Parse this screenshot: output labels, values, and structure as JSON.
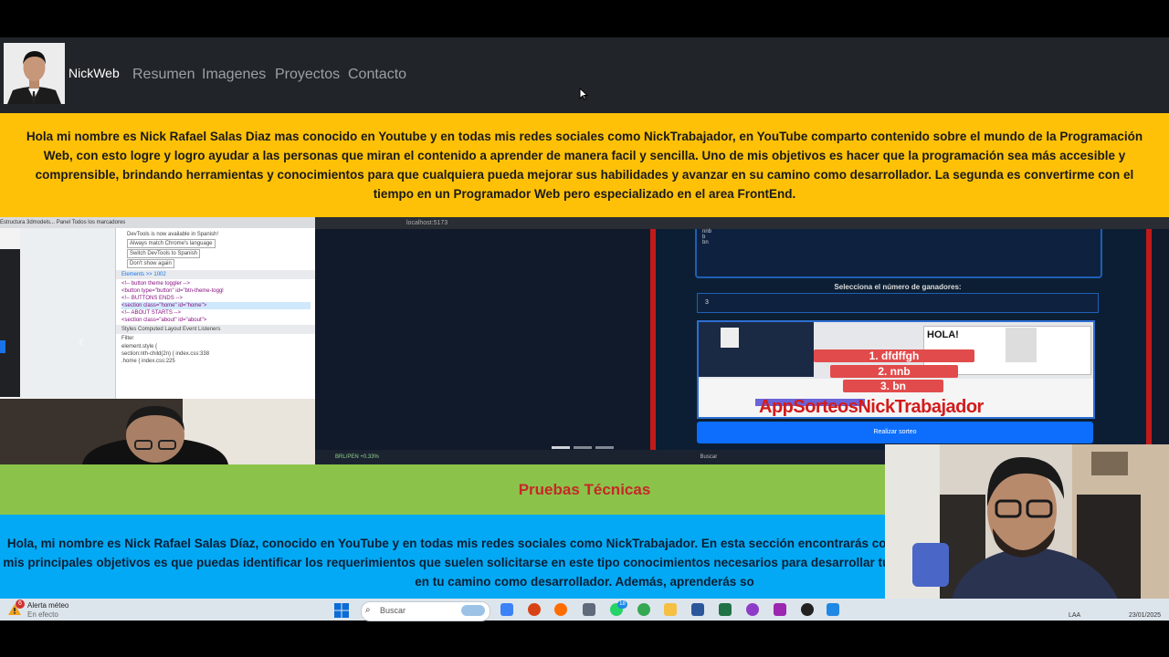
{
  "navbar": {
    "brand": "NickWeb",
    "links": [
      "Resumen",
      "Imagenes",
      "Proyectos",
      "Contacto"
    ]
  },
  "intro": {
    "text": "Hola mi nombre es Nick Rafael Salas Diaz mas conocido en Youtube y en todas mis redes sociales como NickTrabajador, en YouTube comparto contenido sobre el mundo de la Programación Web, con esto logre y logro ayudar a las personas que miran el contenido a aprender de manera facil y sencilla. Uno de mis objetivos es hacer que la programación sea más accesible y comprensible, brindando herramientas y conocimientos para que cualquiera pueda mejorar sus habilidades y avanzar en su camino como desarrollador. La segunda es convertirme con el tiempo en un Programador Web pero especializado en el area FrontEnd."
  },
  "carousel": {
    "devtools": {
      "strip": "Estructura 3dmodels...   Panel                       Todos los marcadores",
      "notice": "DevTools is now available in Spanish!",
      "option1": "Always match Chrome's language",
      "option2": "Switch DevTools to Spanish",
      "option3": "Don't show again",
      "tabs": "Elements  >>   1002",
      "code1": "<!-- button theme toggler -->",
      "code2": "<button type=\"button\" id=\"btn-theme-toggl",
      "code3": "<!-- BUTTONS ENDS -->",
      "code4": "<section class=\"home\" id=\"home\">",
      "code5": "<!-- ABOUT STARTS -->",
      "code6": "<section class=\"about\" id=\"about\">",
      "bottom_tabs": "Styles  Computed  Layout  Event Listeners",
      "filter": "Filter",
      "css1": "element.style {",
      "css2": "section:nth-child(2n) {       index.css:338",
      "css3": ".home {                       index.css:225"
    },
    "app": {
      "url": "localhost:5173",
      "textarea_lines": [
        "nnb",
        "b",
        "bn"
      ],
      "select_label": "Selecciona el número de ganadores:",
      "count": "3",
      "hola": "HOLA!",
      "winners": [
        "1. dfdffgh",
        "2. nnb",
        "3. bn"
      ],
      "watermark": "AppSorteosNickTrabajador",
      "button": "Realizar sorteo",
      "taskbar_search": "Buscar",
      "ticker": "BRL/PEN +0.33%"
    }
  },
  "pruebas": {
    "title": "Pruebas Técnicas",
    "text": "Hola, mi nombre es Nick Rafael Salas Díaz, conocido en YouTube y en todas mis redes sociales como NickTrabajador. En esta sección encontrarás cont cómo se realiza una Prueba Técnica. Uno de mis principales objetivos es que puedas identificar los requerimientos que suelen solicitarse en este tipo conocimientos necesarios para desarrollar tus habilidades de manera efectiva, y así avanzar en tu camino como desarrollador. Además, aprenderás so"
  },
  "taskbar": {
    "weather_title": "Alerta méteo",
    "weather_sub": "En efecto",
    "weather_badge": "6",
    "search": "Buscar",
    "whatsapp_badge": "18",
    "lang": "LAA",
    "date": "23/01/2025",
    "colors": {
      "navbar": "#212529",
      "intro": "#ffc107",
      "pruebas": "#8bc34a",
      "blue": "#03a9f4",
      "title_red": "#c62828"
    }
  }
}
